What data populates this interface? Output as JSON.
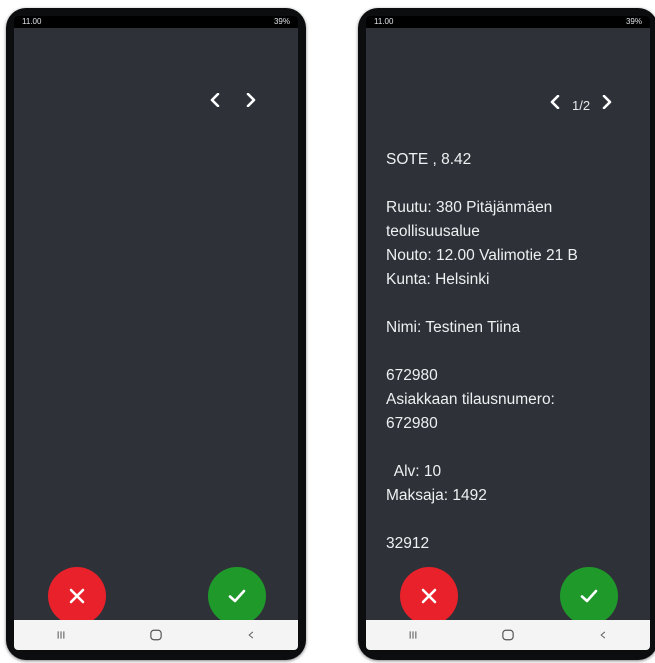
{
  "status_bar": {
    "time": "11.00",
    "right": "39%"
  },
  "colors": {
    "screen_bg": "#2e3238",
    "reject": "#e8212a",
    "accept": "#1f9a2a"
  },
  "icons": {
    "prev": "chevron-left-icon",
    "next": "chevron-right-icon",
    "reject": "close-icon",
    "accept": "check-icon",
    "nav_recents": "recents-icon",
    "nav_home": "home-icon",
    "nav_back": "back-icon"
  },
  "right_screen": {
    "page_indicator": "1/2",
    "lines": [
      "SOTE , 8.42",
      "Ruutu: 380 Pitäjänmäen",
      "teollisuusalue",
      "Nouto: 12.00 Valimotie 21 B",
      "Kunta: Helsinki",
      "Nimi: Testinen Tiina",
      "672980",
      "Asiakkaan tilausnumero:",
      "672980",
      "  Alv: 10",
      "Maksaja: 1492",
      "32912"
    ]
  }
}
